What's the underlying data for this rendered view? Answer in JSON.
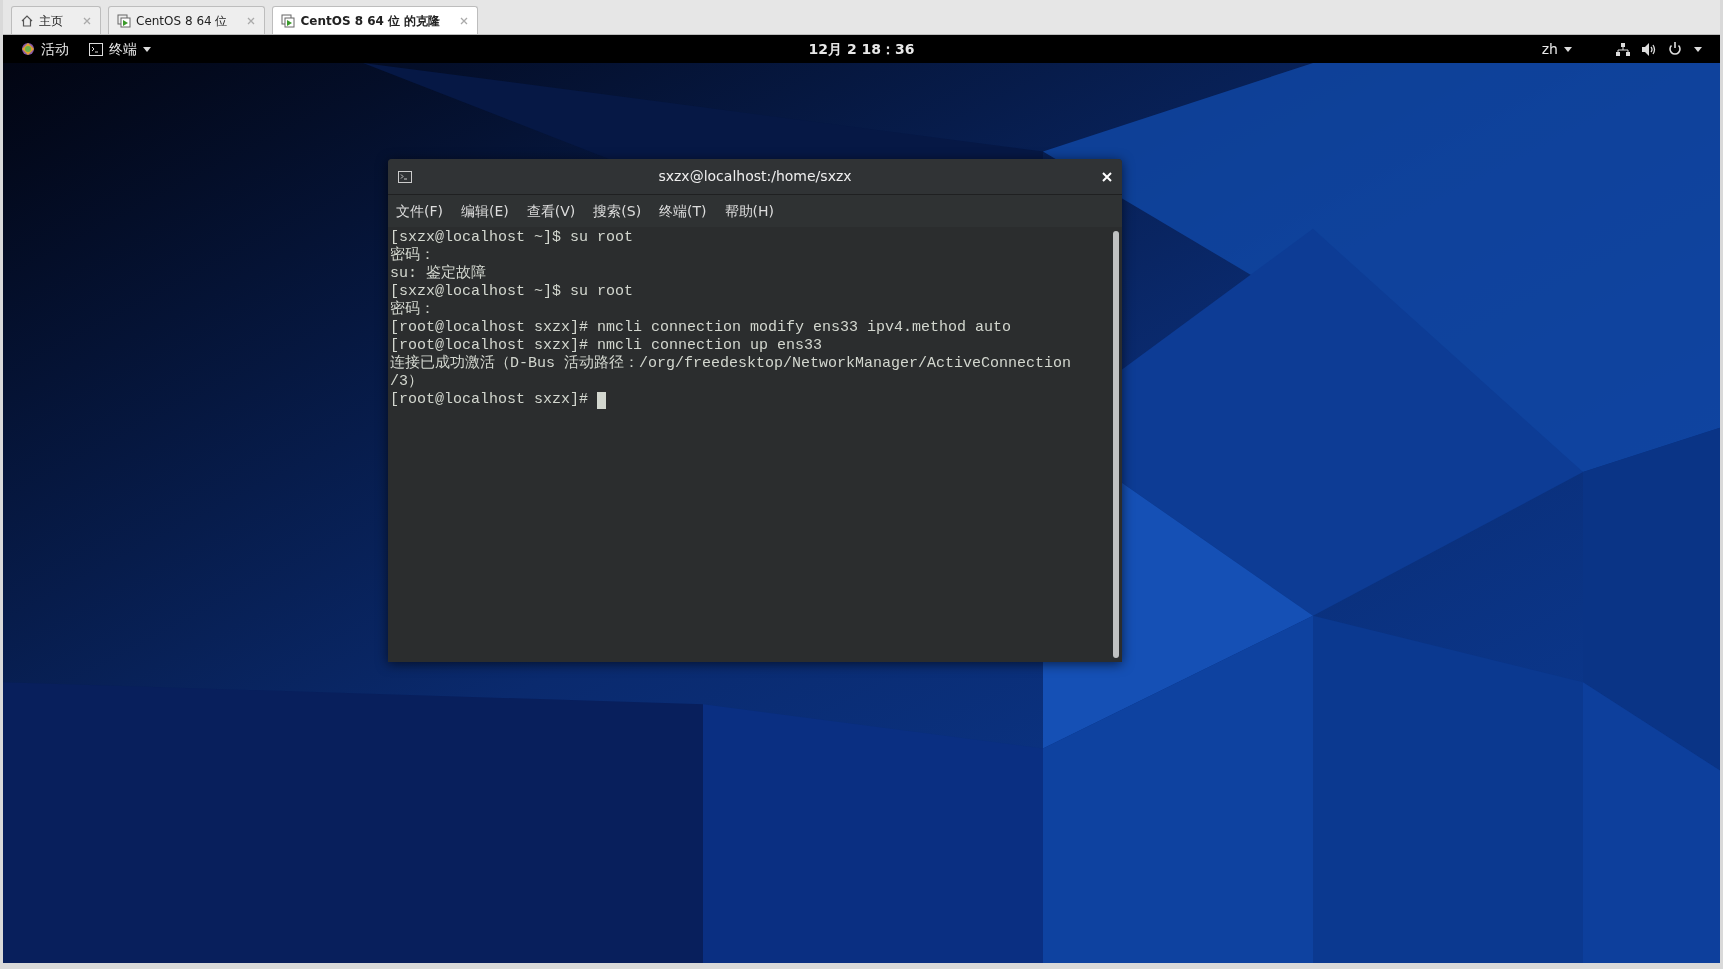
{
  "vm_tabs": [
    {
      "label": "主页",
      "kind": "home",
      "selected": false
    },
    {
      "label": "CentOS 8 64 位",
      "kind": "vm",
      "selected": false
    },
    {
      "label": "CentOS 8 64 位 的克隆",
      "kind": "vm",
      "selected": true
    }
  ],
  "top_bar": {
    "activities": "活动",
    "app_menu": "终端",
    "clock": "12月 2 18：36",
    "input_method": "zh"
  },
  "terminal": {
    "title": "sxzx@localhost:/home/sxzx",
    "menu": [
      "文件(F)",
      "编辑(E)",
      "查看(V)",
      "搜索(S)",
      "终端(T)",
      "帮助(H)"
    ],
    "lines": [
      "[sxzx@localhost ~]$ su root",
      "密码：",
      "su: 鉴定故障",
      "[sxzx@localhost ~]$ su root",
      "密码：",
      "[root@localhost sxzx]# nmcli connection modify ens33 ipv4.method auto",
      "[root@localhost sxzx]# nmcli connection up ens33",
      "连接已成功激活（D-Bus 活动路径：/org/freedesktop/NetworkManager/ActiveConnection",
      "/3）",
      "[root@localhost sxzx]# "
    ],
    "cursor": true
  }
}
